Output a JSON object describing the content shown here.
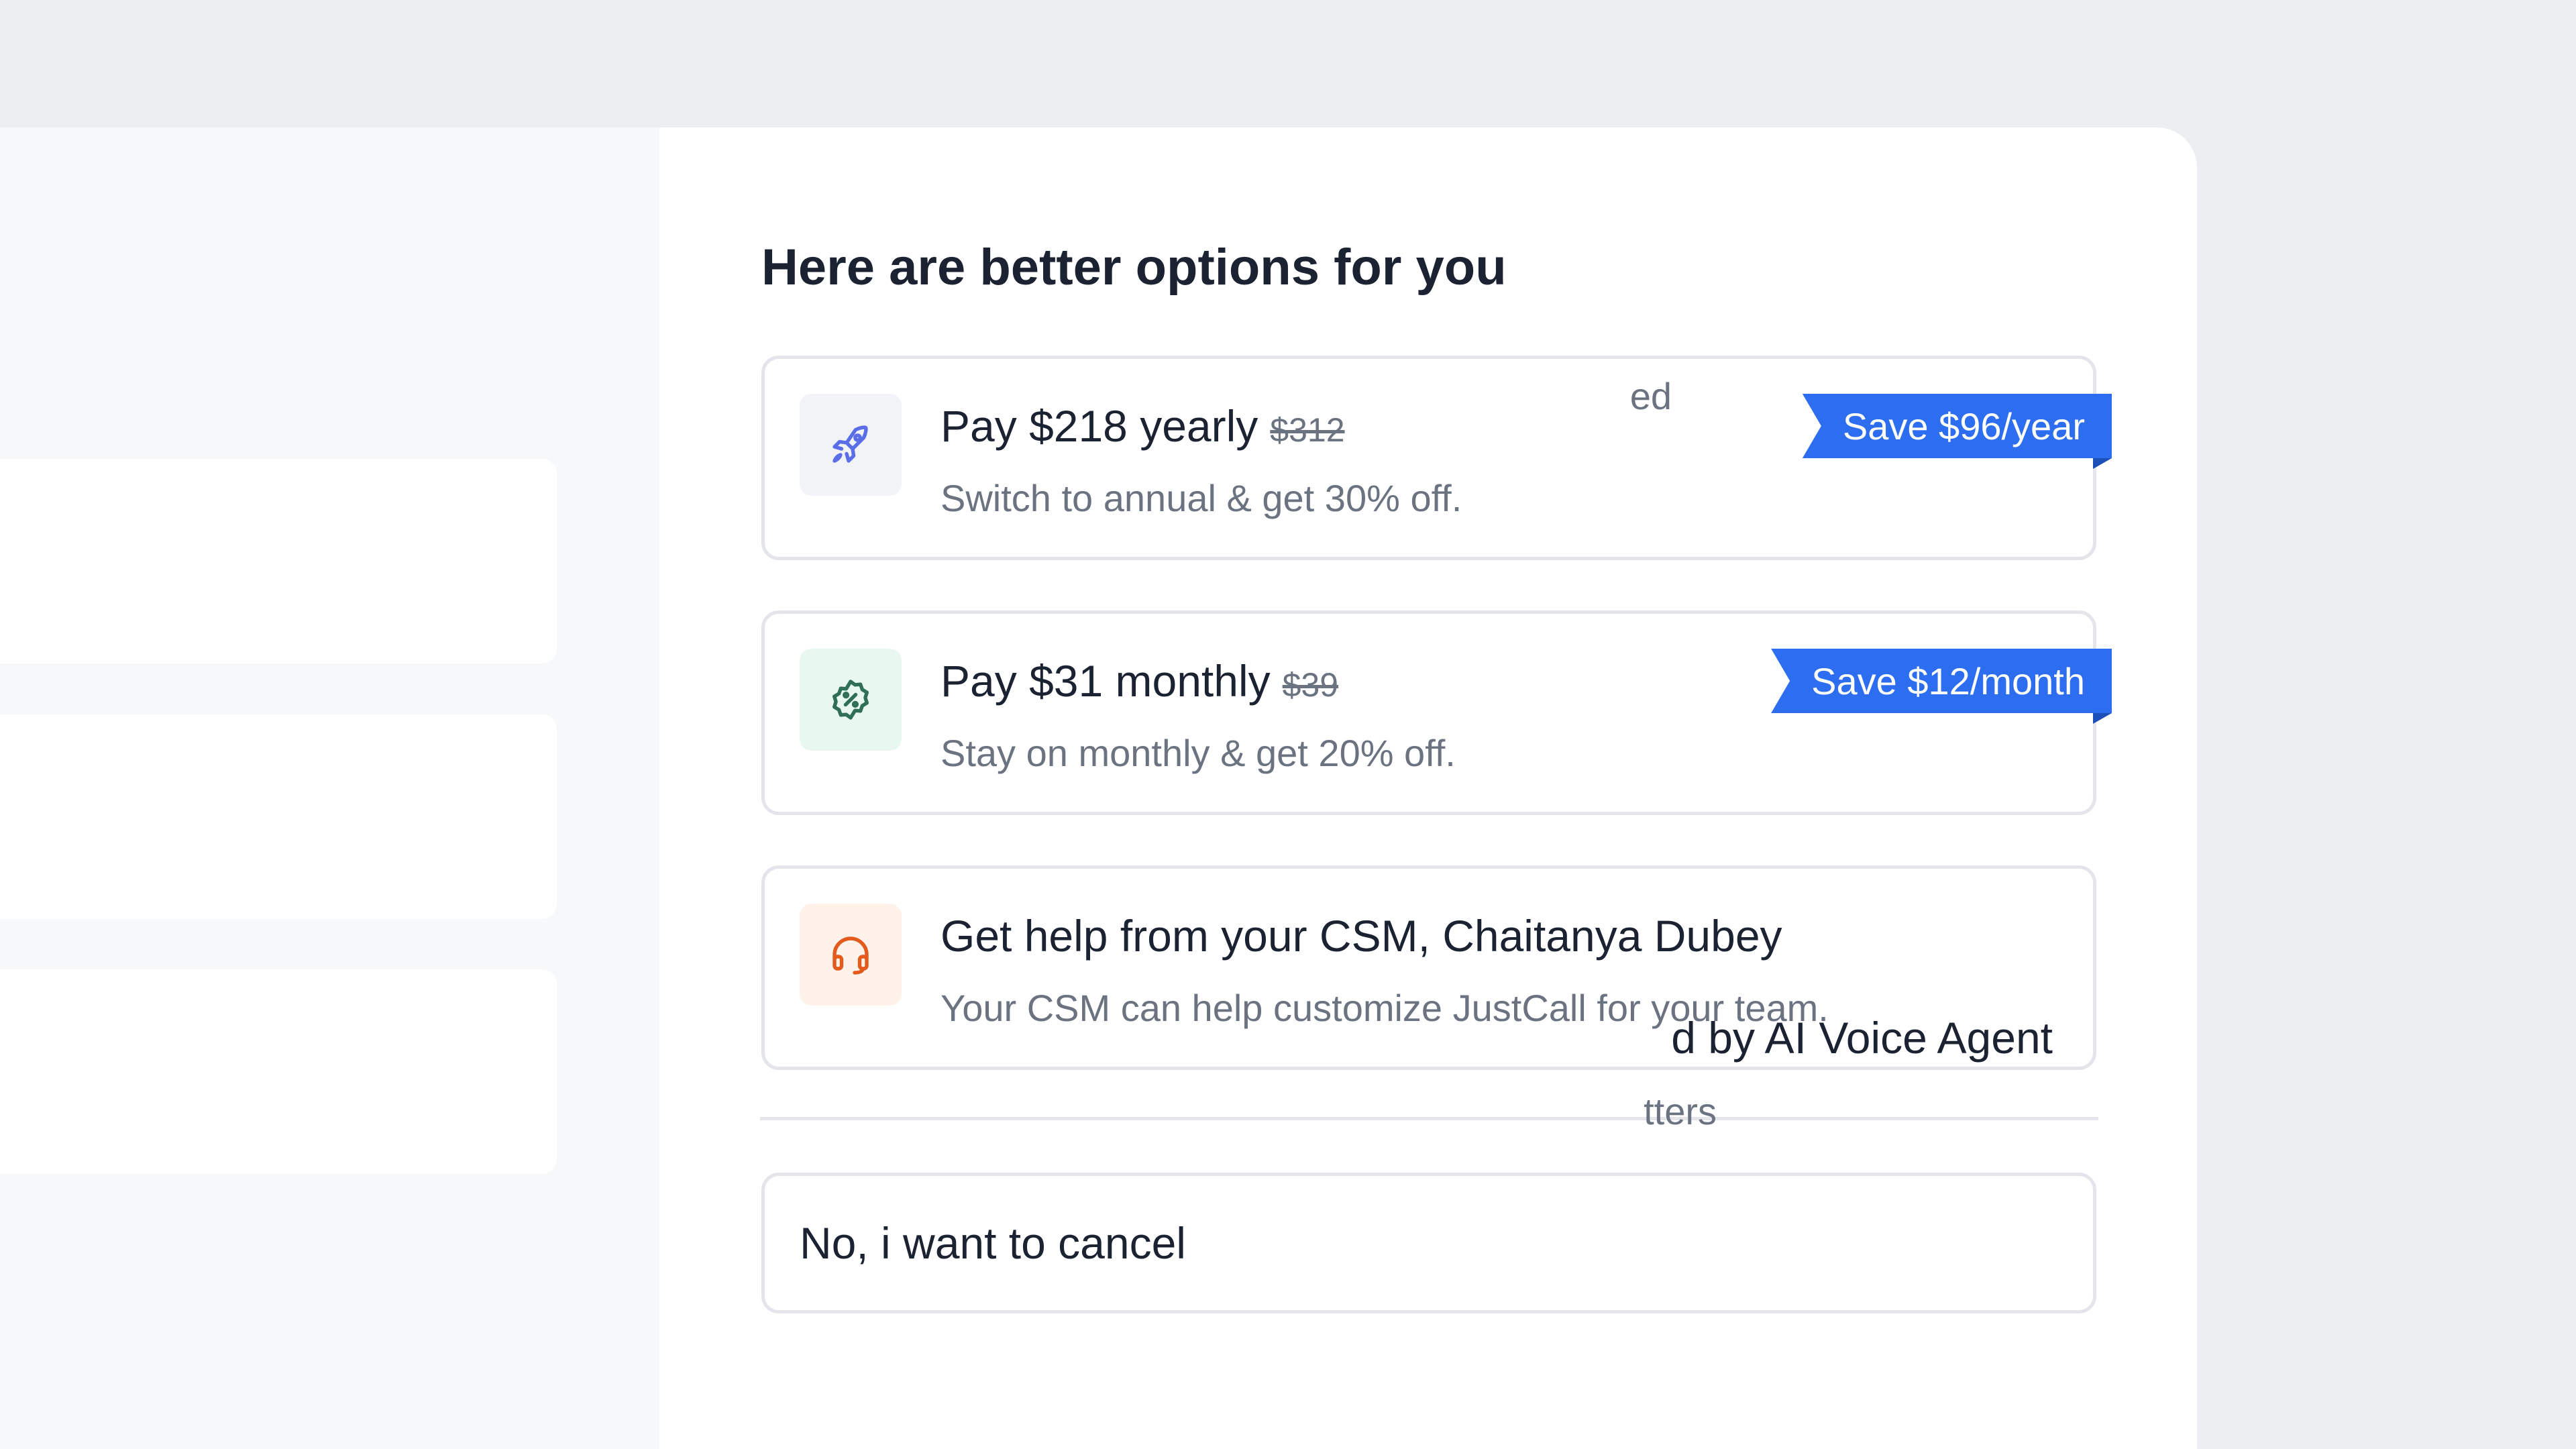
{
  "left_panel": {
    "card2_sub": "ed",
    "card3_title": "d by AI Voice Agent",
    "card3_sub": "tters"
  },
  "heading": "Here are better options for you",
  "options": [
    {
      "title": "Pay $218 yearly",
      "old_price": "$312",
      "subtitle": "Switch to annual & get 30% off.",
      "badge": "Save $96/year",
      "icon": "rocket-icon",
      "icon_color": "#5b6ee8"
    },
    {
      "title": "Pay $31 monthly",
      "old_price": "$39",
      "subtitle": "Stay on monthly & get 20% off.",
      "badge": "Save $12/month",
      "icon": "discount-badge-icon",
      "icon_color": "#2f6f57"
    },
    {
      "title": "Get help from your CSM, Chaitanya Dubey",
      "subtitle": "Your CSM can help customize JustCall for your team.",
      "icon": "headset-icon",
      "icon_color": "#e25a1c"
    }
  ],
  "cancel_label": "No, i want to cancel",
  "colors": {
    "page_bg": "#eceef2",
    "accent": "#2d6ef0",
    "text_primary": "#1b2333",
    "text_secondary": "#6b7280",
    "border": "#e3e5ea"
  }
}
